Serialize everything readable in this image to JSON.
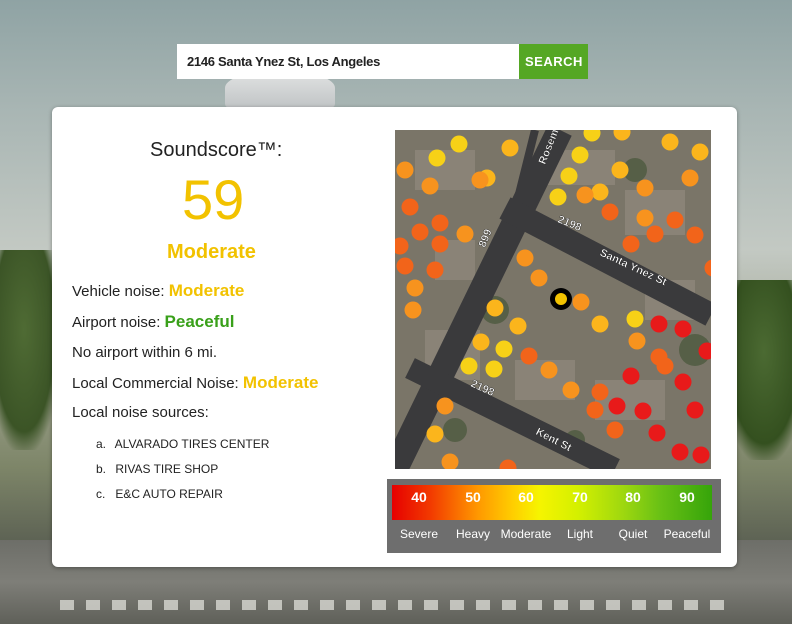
{
  "search": {
    "value": "2146 Santa Ynez St, Los Angeles",
    "button_label": "SEARCH"
  },
  "soundscore": {
    "title": "Soundscore™:",
    "value": "59",
    "level": "Moderate"
  },
  "details": {
    "vehicle_label": "Vehicle noise:",
    "vehicle_value": "Moderate",
    "airport_label": "Airport noise:",
    "airport_value": "Peaceful",
    "airport_note": "No airport within 6 mi.",
    "commercial_label": "Local Commercial Noise:",
    "commercial_value": "Moderate",
    "sources_label": "Local noise sources:",
    "sources": [
      {
        "marker": "a.",
        "name": "ALVARADO TIRES CENTER"
      },
      {
        "marker": "b.",
        "name": "RIVAS TIRE SHOP"
      },
      {
        "marker": "c.",
        "name": "E&C AUTO REPAIR"
      }
    ]
  },
  "map": {
    "street_labels": [
      "Rosem",
      "2198",
      "Santa Ynez St",
      "899",
      "2198",
      "Kent St"
    ],
    "colors": {
      "red": "#e81a1a",
      "orange_red": "#f2641a",
      "orange": "#f7931e",
      "yellow_orange": "#fbb51c",
      "yellow": "#f7d117",
      "marker_ring": "#000000",
      "marker_fill": "#f2c200"
    }
  },
  "legend": {
    "values": [
      "40",
      "50",
      "60",
      "70",
      "80",
      "90"
    ],
    "labels": [
      "Severe",
      "Heavy",
      "Moderate",
      "Light",
      "Quiet",
      "Peaceful"
    ]
  },
  "colors": {
    "accent_yellow": "#f2c200",
    "accent_green": "#39a01a",
    "search_button": "#55a724"
  }
}
